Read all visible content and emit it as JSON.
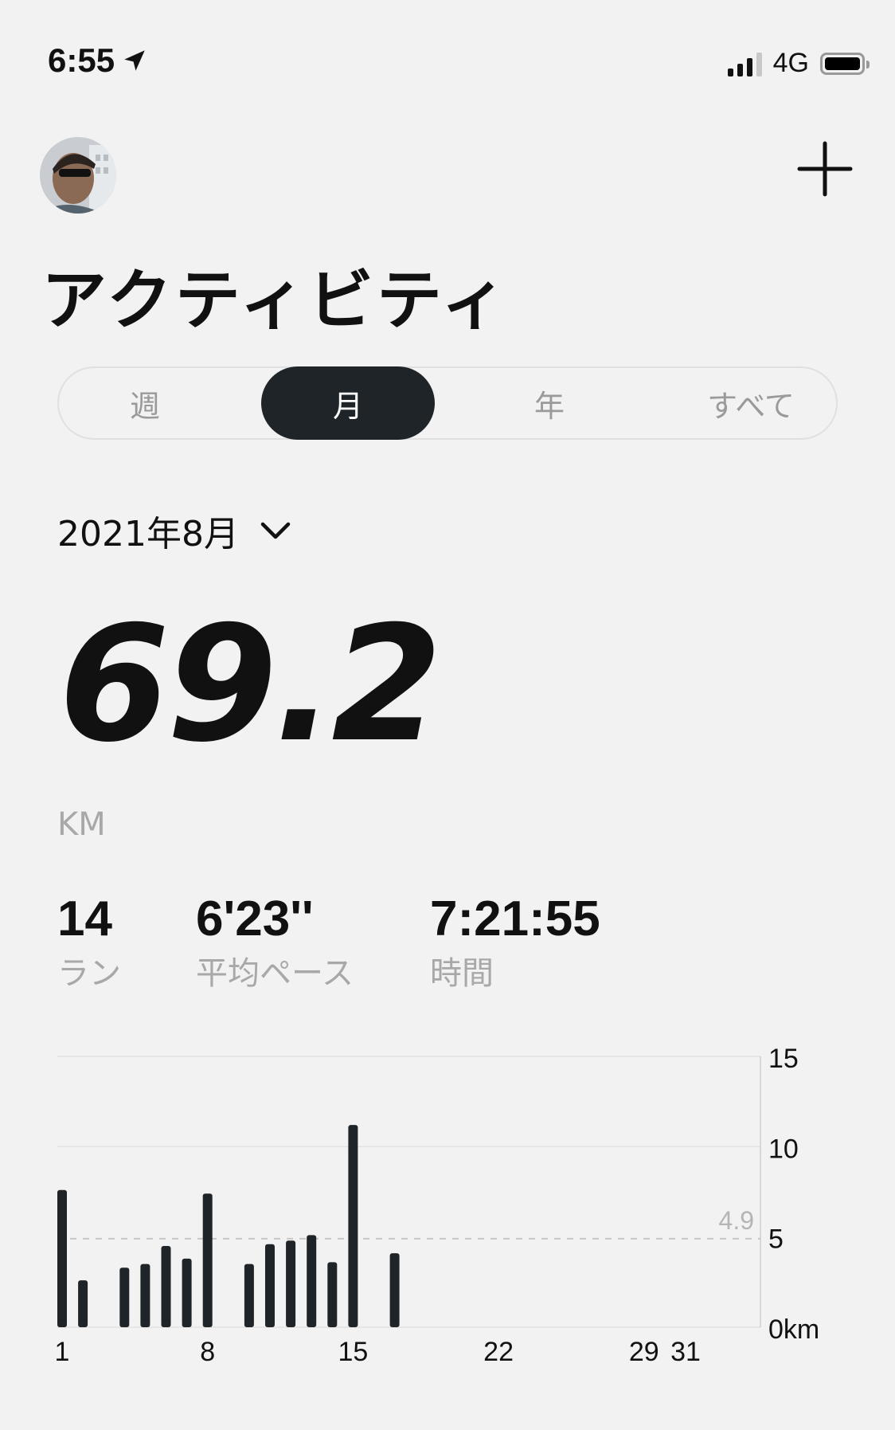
{
  "status_bar": {
    "time": "6:55",
    "network": "4G"
  },
  "header": {
    "title": "アクティビティ"
  },
  "tabs": [
    {
      "label": "週"
    },
    {
      "label": "月"
    },
    {
      "label": "年"
    },
    {
      "label": "すべて"
    }
  ],
  "active_tab": "月",
  "period": {
    "label": "2021年8月"
  },
  "summary": {
    "distance": "69.2",
    "unit": "KM"
  },
  "stats": [
    {
      "value": "14",
      "label": "ラン"
    },
    {
      "value": "6'23''",
      "label": "平均ペース"
    },
    {
      "value": "7:21:55",
      "label": "時間"
    }
  ],
  "icons": [
    "location-arrow-icon",
    "signal-icon",
    "battery-icon",
    "avatar",
    "plus-icon",
    "chevron-down-icon"
  ],
  "colors": {
    "bar": "#1f2428",
    "accent_dark": "#1f2428",
    "muted_text": "#a8a8a8",
    "background": "#f2f2f2"
  },
  "chart_data": {
    "type": "bar",
    "x": [
      1,
      2,
      4,
      5,
      6,
      7,
      8,
      10,
      11,
      12,
      13,
      14,
      15,
      17
    ],
    "values": [
      7.6,
      2.6,
      3.3,
      3.5,
      4.5,
      3.8,
      7.4,
      3.5,
      4.6,
      4.8,
      5.1,
      3.6,
      11.2,
      4.1
    ],
    "xlim": [
      1,
      31
    ],
    "x_ticks": [
      "1",
      "8",
      "15",
      "22",
      "29",
      "31"
    ],
    "y_ticks": [
      "15",
      "10",
      "5",
      "0km"
    ],
    "ylim": [
      0,
      15
    ],
    "average": 4.9,
    "average_label": "4.9",
    "grid": true
  }
}
